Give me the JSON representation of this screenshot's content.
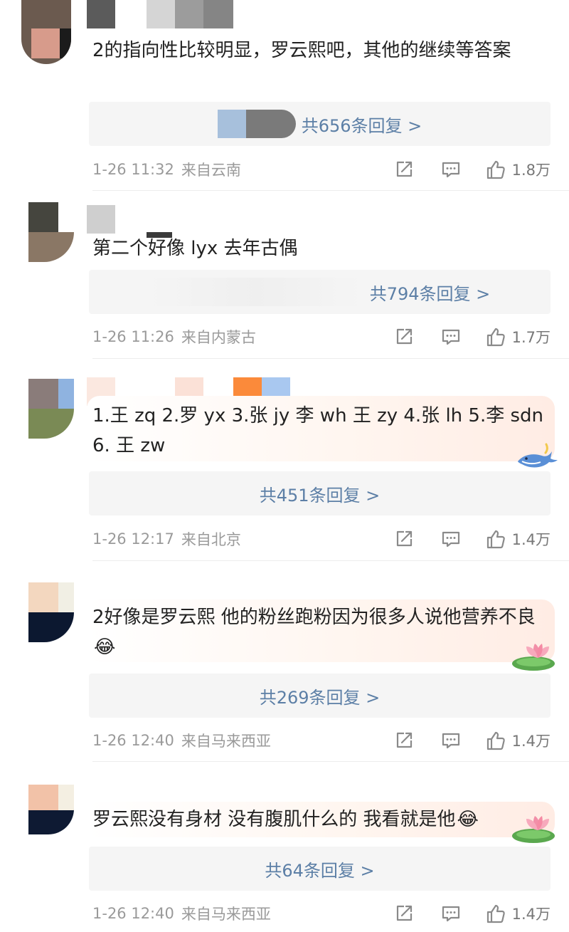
{
  "comments": [
    {
      "text": "2的指向性比较明显，罗云熙吧，其他的继续等答案",
      "replies_label": "共656条回复 >",
      "time": "1-26 11:32",
      "location": "来自云南",
      "likes": "1.8万"
    },
    {
      "text": "第二个好像 lyx 去年古偶",
      "replies_label": "共794条回复 >",
      "time": "1-26 11:26",
      "location": "来自内蒙古",
      "likes": "1.7万"
    },
    {
      "text": "1.王 zq 2.罗 yx 3.张 jy 李 wh 王 zy 4.张 lh 5.李 sdn 6. 王 zw",
      "replies_label": "共451条回复 >",
      "time": "1-26 12:17",
      "location": "来自北京",
      "likes": "1.4万"
    },
    {
      "text": "2好像是罗云熙 他的粉丝跑粉因为很多人说他营养不良",
      "emoji": "😂",
      "replies_label": "共269条回复 >",
      "time": "1-26 12:40",
      "location": "来自马来西亚",
      "likes": "1.4万"
    },
    {
      "text": "罗云熙没有身材 没有腹肌什么的 我看就是他",
      "emoji": "😂",
      "replies_label": "共64条回复 >",
      "time": "1-26 12:40",
      "location": "来自马来西亚",
      "likes": "1.4万"
    }
  ],
  "icons": {
    "share": "share-icon",
    "comment": "comment-icon",
    "like": "thumbs-up-icon"
  },
  "colors": {
    "link": "#5c7fa6",
    "meta": "#9a9a9a",
    "reply_bg": "#f5f5f5"
  }
}
